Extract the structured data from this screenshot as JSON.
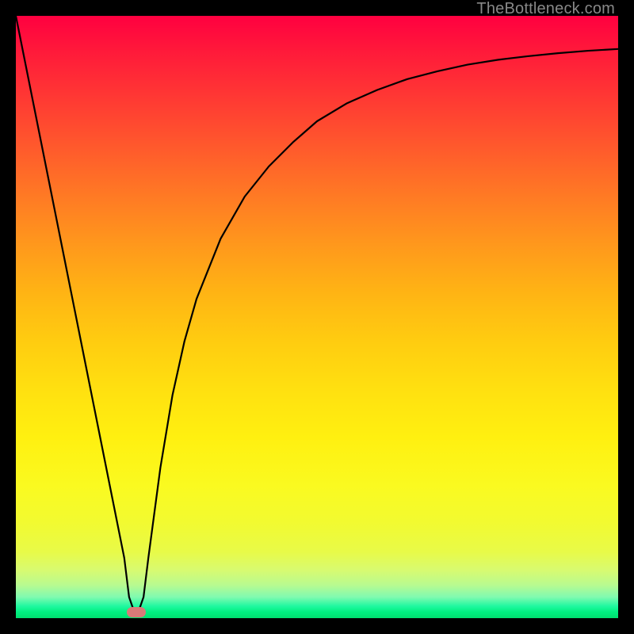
{
  "watermark": "TheBottleneck.com",
  "colors": {
    "curve": "#000000",
    "marker": "#d97a78",
    "frame": "#000000"
  },
  "chart_data": {
    "type": "line",
    "title": "",
    "xlabel": "",
    "ylabel": "",
    "xlim": [
      0,
      100
    ],
    "ylim": [
      0,
      100
    ],
    "grid": false,
    "legend": false,
    "series": [
      {
        "name": "bottleneck-curve",
        "x": [
          0,
          2,
          4,
          6,
          8,
          10,
          12,
          14,
          16,
          18,
          18.8,
          19.6,
          20.4,
          21.2,
          22,
          24,
          26,
          28,
          30,
          34,
          38,
          42,
          46,
          50,
          55,
          60,
          65,
          70,
          75,
          80,
          85,
          90,
          95,
          100
        ],
        "values": [
          100,
          90,
          80,
          70,
          60,
          50,
          40,
          30,
          20,
          10,
          3.5,
          1.2,
          1.2,
          3.5,
          10,
          25,
          37,
          46,
          53,
          63,
          70,
          75,
          79,
          82.5,
          85.5,
          87.7,
          89.5,
          90.8,
          91.9,
          92.7,
          93.3,
          93.8,
          94.2,
          94.5
        ]
      }
    ],
    "marker": {
      "x": 20,
      "y": 1
    }
  }
}
